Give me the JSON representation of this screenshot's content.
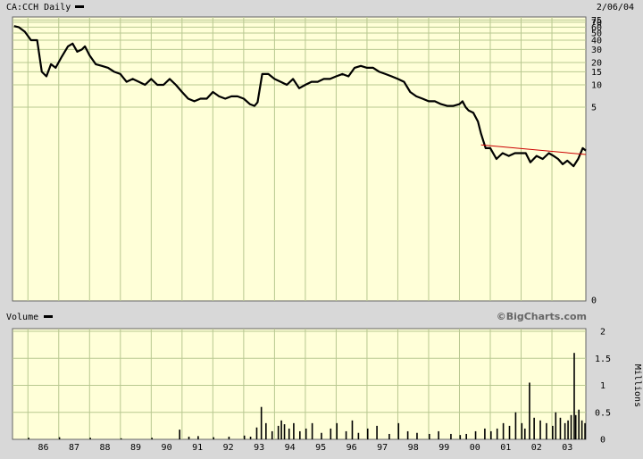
{
  "header": {
    "symbol_label": "CA:CCH Daily",
    "date": "2/06/04"
  },
  "volume_panel": {
    "label": "Volume",
    "brand": "©BigCharts.com",
    "unit_label": "Millions"
  },
  "colors": {
    "background": "#d8d8d8",
    "plot_bg": "#ffffd8",
    "grid": "#b8c890",
    "price": "#000000",
    "trendline": "#cc0000"
  },
  "chart_data": [
    {
      "type": "line",
      "title": "CA:CCH Daily",
      "scale": "log",
      "ytick_labels": [
        "75",
        "70",
        "60",
        "50",
        "40",
        "30",
        "20",
        "15",
        "10",
        "5",
        "0"
      ],
      "ytick_values": [
        75,
        70,
        60,
        50,
        40,
        30,
        20,
        15,
        10,
        5,
        0
      ],
      "ylim": [
        0.5,
        75
      ],
      "xtick_labels": [
        "86",
        "87",
        "88",
        "89",
        "90",
        "91",
        "92",
        "93",
        "94",
        "95",
        "96",
        "97",
        "98",
        "99",
        "00",
        "01",
        "02",
        "03"
      ],
      "xlim": [
        1985.5,
        2004.1
      ],
      "x": [
        1985.55,
        1985.7,
        1985.9,
        1986.1,
        1986.3,
        1986.45,
        1986.6,
        1986.75,
        1986.9,
        1987.1,
        1987.3,
        1987.45,
        1987.6,
        1987.75,
        1987.85,
        1988.0,
        1988.2,
        1988.4,
        1988.6,
        1988.8,
        1989.0,
        1989.2,
        1989.4,
        1989.6,
        1989.8,
        1990.0,
        1990.2,
        1990.4,
        1990.6,
        1990.8,
        1991.0,
        1991.2,
        1991.4,
        1991.6,
        1991.8,
        1992.0,
        1992.2,
        1992.4,
        1992.6,
        1992.8,
        1993.0,
        1993.2,
        1993.35,
        1993.45,
        1993.6,
        1993.8,
        1994.0,
        1994.2,
        1994.4,
        1994.6,
        1994.8,
        1995.0,
        1995.2,
        1995.4,
        1995.6,
        1995.8,
        1996.0,
        1996.2,
        1996.4,
        1996.6,
        1996.8,
        1997.0,
        1997.2,
        1997.4,
        1997.6,
        1997.8,
        1998.0,
        1998.2,
        1998.4,
        1998.6,
        1998.8,
        1999.0,
        1999.2,
        1999.4,
        1999.6,
        1999.8,
        2000.0,
        2000.1,
        2000.2,
        2000.3,
        2000.45,
        2000.6,
        2000.7,
        2000.85,
        2001.0,
        2001.2,
        2001.4,
        2001.6,
        2001.8,
        2002.0,
        2002.15,
        2002.3,
        2002.5,
        2002.7,
        2002.9,
        2003.05,
        2003.2,
        2003.35,
        2003.5,
        2003.7,
        2003.85,
        2004.0,
        2004.1
      ],
      "y": [
        62,
        60,
        52,
        40,
        40,
        15,
        13,
        19,
        17,
        24,
        33,
        36,
        28,
        30,
        33,
        25,
        19,
        18,
        17,
        15,
        14,
        11,
        12,
        11,
        10,
        12,
        10,
        10,
        12,
        10,
        8,
        6.5,
        6,
        6.5,
        6.5,
        8,
        7,
        6.5,
        7,
        7,
        6.5,
        5.5,
        5.2,
        5.8,
        14,
        14,
        12,
        11,
        10,
        12,
        9,
        10,
        11,
        11,
        12,
        12,
        13,
        14,
        13,
        17,
        18,
        17,
        17,
        15,
        14,
        13,
        12,
        11,
        8,
        7,
        6.5,
        6,
        6,
        5.5,
        5.2,
        5.2,
        5.5,
        6,
        5,
        4.5,
        4.2,
        3.2,
        2.2,
        1.4,
        1.4,
        1.0,
        1.2,
        1.1,
        1.2,
        1.2,
        1.2,
        0.9,
        1.1,
        1.0,
        1.2,
        1.1,
        1.0,
        0.85,
        0.95,
        0.8,
        1.0,
        1.4,
        1.3
      ],
      "trendline": {
        "x": [
          2000.7,
          2004.1
        ],
        "y": [
          1.55,
          1.15
        ]
      }
    },
    {
      "type": "bar",
      "title": "Volume",
      "ylabel": "Millions",
      "ytick_labels": [
        "2",
        "1.5",
        "1",
        "0.5",
        "0"
      ],
      "ylim": [
        0,
        2
      ],
      "xtick_labels": [
        "86",
        "87",
        "88",
        "89",
        "90",
        "91",
        "92",
        "93",
        "94",
        "95",
        "96",
        "97",
        "98",
        "99",
        "00",
        "01",
        "02",
        "03"
      ],
      "xlim": [
        1985.5,
        2004.1
      ],
      "x": [
        1986.0,
        1987.0,
        1988.0,
        1989.0,
        1990.0,
        1990.9,
        1991.2,
        1991.5,
        1992.0,
        1992.5,
        1993.0,
        1993.2,
        1993.4,
        1993.55,
        1993.7,
        1993.9,
        1994.1,
        1994.2,
        1994.3,
        1994.45,
        1994.6,
        1994.8,
        1995.0,
        1995.2,
        1995.5,
        1995.8,
        1996.0,
        1996.3,
        1996.5,
        1996.7,
        1997.0,
        1997.3,
        1997.7,
        1998.0,
        1998.3,
        1998.6,
        1999.0,
        1999.3,
        1999.7,
        2000.0,
        2000.2,
        2000.5,
        2000.8,
        2001.0,
        2001.2,
        2001.4,
        2001.6,
        2001.8,
        2002.0,
        2002.1,
        2002.25,
        2002.4,
        2002.6,
        2002.8,
        2003.0,
        2003.1,
        2003.25,
        2003.4,
        2003.5,
        2003.6,
        2003.7,
        2003.75,
        2003.85,
        2003.95,
        2004.05
      ],
      "values": [
        0.03,
        0.04,
        0.03,
        0.02,
        0.03,
        0.18,
        0.05,
        0.06,
        0.04,
        0.05,
        0.07,
        0.05,
        0.22,
        0.6,
        0.3,
        0.15,
        0.25,
        0.35,
        0.28,
        0.2,
        0.3,
        0.15,
        0.2,
        0.3,
        0.12,
        0.2,
        0.3,
        0.15,
        0.35,
        0.12,
        0.2,
        0.25,
        0.1,
        0.3,
        0.15,
        0.12,
        0.1,
        0.15,
        0.1,
        0.08,
        0.1,
        0.15,
        0.2,
        0.15,
        0.2,
        0.3,
        0.25,
        0.5,
        0.3,
        0.2,
        1.05,
        0.4,
        0.35,
        0.3,
        0.25,
        0.5,
        0.4,
        0.3,
        0.35,
        0.45,
        1.6,
        0.45,
        0.55,
        0.35,
        0.3
      ]
    }
  ]
}
